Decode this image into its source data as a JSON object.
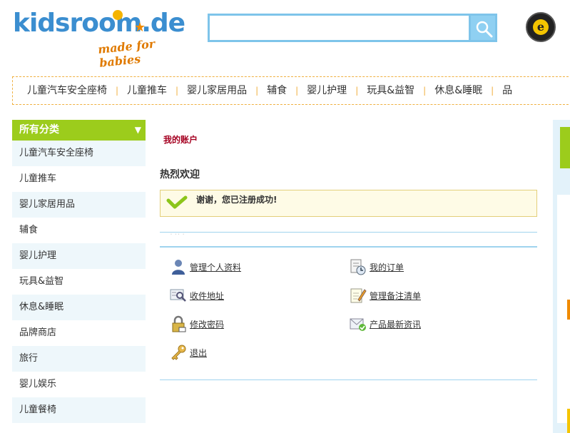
{
  "header": {
    "logo_text": "kidsroom.de",
    "logo_tagline": "made for babies",
    "search_placeholder": "",
    "trust_badge_letter": "e"
  },
  "topnav": {
    "items": [
      "儿童汽车安全座椅",
      "儿童推车",
      "婴儿家居用品",
      "辅食",
      "婴儿护理",
      "玩具&益智",
      "休息&睡眠",
      "品"
    ],
    "separator": "|"
  },
  "sidebar": {
    "title": "所有分类",
    "arrow": "▼",
    "items": [
      "儿童汽车安全座椅",
      "儿童推车",
      "婴儿家居用品",
      "辅食",
      "婴儿护理",
      "玩具&益智",
      "休息&睡眠",
      "品牌商店",
      "旅行",
      "婴儿娱乐",
      "儿童餐椅"
    ]
  },
  "main": {
    "breadcrumb": "我的账户",
    "welcome": "热烈欢迎",
    "success_message": "谢谢，您已注册成功!",
    "links": {
      "profile": "管理个人资料",
      "orders": "我的订单",
      "address": "收件地址",
      "wishlist": "管理备注清单",
      "password": "修改密码",
      "newsletter": "产品最新资讯",
      "logout": "退出"
    }
  },
  "colors": {
    "accent_green": "#9ccc1c",
    "accent_blue": "#7ec4ea",
    "breadcrumb_red": "#a50021",
    "nav_border_orange": "#f0b040"
  }
}
